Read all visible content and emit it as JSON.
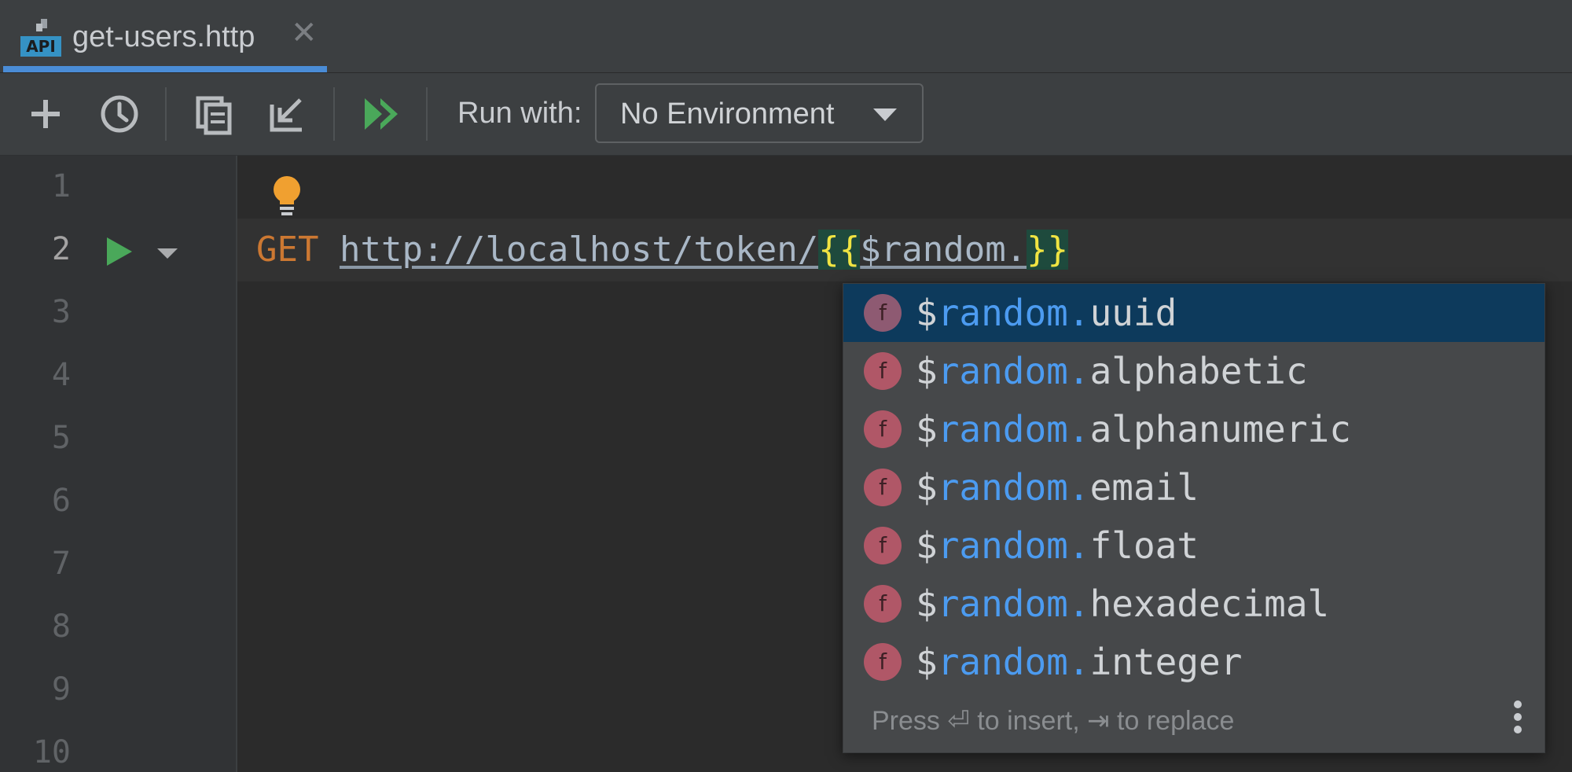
{
  "tab": {
    "title": "get-users.http",
    "icon_label": "API",
    "close": "✕"
  },
  "toolbar": {
    "run_with_label": "Run with:",
    "environment": "No Environment"
  },
  "gutter": {
    "line_numbers": [
      "1",
      "2",
      "3",
      "4",
      "5",
      "6",
      "7",
      "8",
      "9",
      "10"
    ]
  },
  "editor": {
    "method": "GET",
    "url": "http://localhost/token/",
    "open_brace": "{{",
    "var_text": "$random.",
    "close_brace": "}}"
  },
  "completion": {
    "badge": "f",
    "prefix_dollar": "$",
    "prefix_match": "random.",
    "items": [
      {
        "suffix": "uuid"
      },
      {
        "suffix": "alphabetic"
      },
      {
        "suffix": "alphanumeric"
      },
      {
        "suffix": "email"
      },
      {
        "suffix": "float"
      },
      {
        "suffix": "hexadecimal"
      },
      {
        "suffix": "integer"
      }
    ],
    "selected_index": 0,
    "footer": "Press ⏎ to insert, ⇥ to replace"
  },
  "colors": {
    "accent": "#4a8cd6",
    "keyword": "#cc7832",
    "match": "#4c9bf0",
    "brace": "#f0e442",
    "run_green": "#4aa85a",
    "bulb": "#f0a030"
  }
}
